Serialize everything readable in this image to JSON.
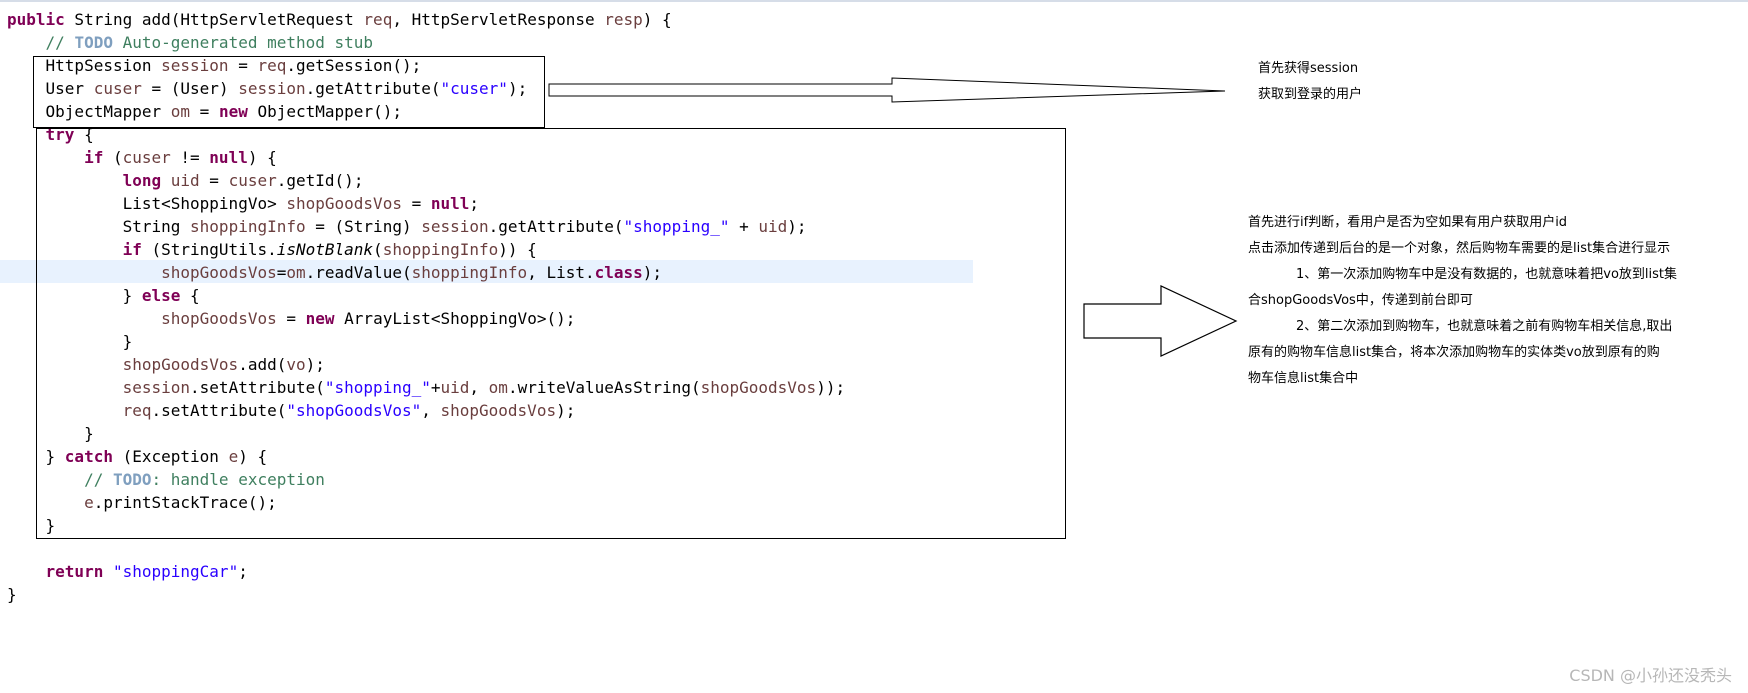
{
  "code": {
    "signature": {
      "kw_public": "public",
      "rest": " String add(HttpServletRequest ",
      "param1": "req",
      "mid": ", HttpServletResponse ",
      "param2": "resp",
      "end": ") {"
    },
    "comment_autogen": {
      "prefix": "// ",
      "todo": "TODO",
      "text": " Auto-generated method stub"
    },
    "session_line": {
      "type": "HttpSession ",
      "var": "session",
      "eq": " = ",
      "recv": "req",
      "call": ".getSession();"
    },
    "user_line": {
      "type": "User ",
      "var": "cuser",
      "cast": " = (User) ",
      "recv": "session",
      "call": ".getAttribute(",
      "str": "\"cuser\"",
      "end": ");"
    },
    "mapper_line": {
      "type": "ObjectMapper ",
      "var": "om",
      "eq": " = ",
      "kw_new": "new",
      "call": " ObjectMapper();"
    },
    "try_line": {
      "kw_try": "try",
      "brace": " {"
    },
    "if_cuser": {
      "kw_if": "if",
      "open": " (",
      "var": "cuser",
      "op": " != ",
      "kw_null": "null",
      "end": ") {"
    },
    "uid_line": {
      "kw_long": "long",
      "sp": " ",
      "var": "uid",
      "eq": " = ",
      "recv": "cuser",
      "call": ".getId();"
    },
    "list_line": {
      "type": "List<ShoppingVo> ",
      "var": "shopGoodsVos",
      "eq": " = ",
      "kw_null": "null",
      "end": ";"
    },
    "info_line": {
      "type": "String ",
      "var": "shoppingInfo",
      "cast": " = (String) ",
      "recv": "session",
      "call": ".getAttribute(",
      "str": "\"shopping_\"",
      "plus": " + ",
      "uid": "uid",
      "end": ");"
    },
    "if_blank": {
      "kw_if": "if",
      "open": " (StringUtils.",
      "method": "isNotBlank",
      "paren": "(",
      "var": "shoppingInfo",
      "end": ")) {"
    },
    "read_line": {
      "var": "shopGoodsVos",
      "eq": "=",
      "recv": "om",
      "call": ".readValue(",
      "arg": "shoppingInfo",
      "mid": ", List.",
      "kw_class": "class",
      "end": ");"
    },
    "else_line": {
      "open": "} ",
      "kw_else": "else",
      "brace": " {"
    },
    "new_list_line": {
      "var": "shopGoodsVos",
      "eq": " = ",
      "kw_new": "new",
      "call": " ArrayList<ShoppingVo>();"
    },
    "close_if": "}",
    "add_line": {
      "var": "shopGoodsVos",
      "call": ".add(",
      "arg": "vo",
      "end": ");"
    },
    "set_session_line": {
      "recv": "session",
      "call": ".setAttribute(",
      "str": "\"shopping_\"",
      "plus": "+",
      "uid": "uid",
      "comma": ", ",
      "om": "om",
      "call2": ".writeValueAsString(",
      "arg": "shopGoodsVos",
      "end": "));"
    },
    "set_req_line": {
      "recv": "req",
      "call": ".setAttribute(",
      "str": "\"shopGoodsVos\"",
      "comma": ", ",
      "arg": "shopGoodsVos",
      "end": ");"
    },
    "close_outer_if": "}",
    "catch_line": {
      "open": "} ",
      "kw_catch": "catch",
      "mid": " (Exception ",
      "var": "e",
      "end": ") {"
    },
    "comment_handle": {
      "prefix": "// ",
      "todo": "TODO",
      "text": ": handle exception"
    },
    "print_line": {
      "var": "e",
      "call": ".printStackTrace();"
    },
    "close_try": "}",
    "return_line": {
      "kw_return": "return",
      "sp": " ",
      "str": "\"shoppingCar\"",
      "end": ";"
    },
    "close_method": "}"
  },
  "annotations": {
    "top_note": [
      "首先获得session",
      "获取到登录的用户"
    ],
    "right_note": {
      "line1": "首先进行if判断，看用户是否为空如果有用户获取用户id",
      "line2": "点击添加传递到后台的是一个对象，然后购物车需要的是list集合进行显示",
      "line3": "1、第一次添加购物车中是没有数据的，也就意味着把vo放到list集",
      "line4": "合shopGoodsVos中，传递到前台即可",
      "line5": "2、第二次添加到购物车，也就意味着之前有购物车相关信息,取出",
      "line6": "原有的购物车信息list集合，将本次添加购物车的实体类vo放到原有的购",
      "line7": "物车信息list集合中"
    }
  },
  "watermark": "CSDN @小孙还没秃头",
  "colors": {
    "keyword": "#7f0055",
    "comment": "#3f7f5f",
    "todo": "#7f9fbf",
    "string": "#2a00ff",
    "variable": "#6a3e3e",
    "current_line_highlight": "#e8f2fe"
  }
}
